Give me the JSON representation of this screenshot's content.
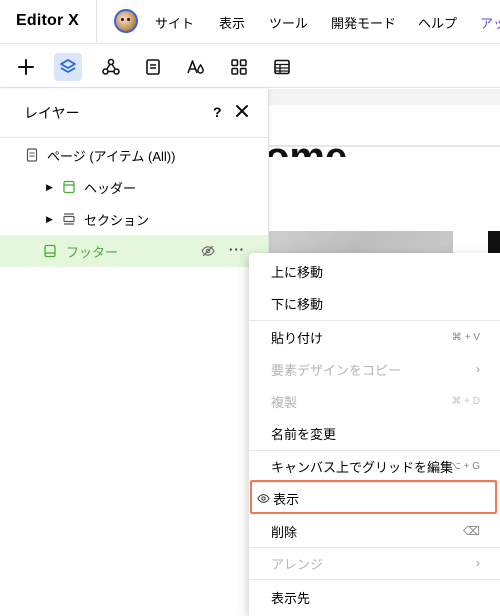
{
  "topbar": {
    "logo": "Editor X",
    "menu": [
      "サイト",
      "表示",
      "ツール",
      "開発モード",
      "ヘルプ",
      "アップ"
    ]
  },
  "toolbar": {
    "tools": [
      "add-icon",
      "layers-icon",
      "connect-icon",
      "pages-icon",
      "text-theme-icon",
      "apps-icon",
      "table-icon"
    ],
    "active": "layers-icon"
  },
  "layers_panel": {
    "title": "レイヤー",
    "help": "?",
    "items": [
      {
        "label": "ページ (アイテム (All))",
        "icon": "page-icon"
      },
      {
        "label": "ヘッダー",
        "icon": "header-icon"
      },
      {
        "label": "セクション",
        "icon": "section-icon"
      },
      {
        "label": "フッター",
        "icon": "footer-icon",
        "selected": true
      }
    ]
  },
  "context_menu": {
    "items": [
      {
        "label": "上に移動"
      },
      {
        "label": "下に移動"
      },
      {
        "label": "貼り付け",
        "shortcut": "⌘ + V"
      },
      {
        "label": "要素デザインをコピー",
        "disabled": true,
        "submenu": "›"
      },
      {
        "label": "複製",
        "disabled": true,
        "shortcut": "⌘ + D"
      },
      {
        "label": "名前を変更"
      },
      {
        "label": "キャンバス上でグリッドを編集",
        "shortcut": "⌥ + G"
      },
      {
        "label": "表示",
        "highlighted": true
      },
      {
        "label": "削除",
        "shortcut": "⌫"
      },
      {
        "label": "アレンジ",
        "disabled": true,
        "submenu": "›"
      },
      {
        "label": "表示先"
      }
    ]
  },
  "canvas": {
    "heading_fragment": "ome"
  },
  "colors": {
    "accent": "#6a45e6",
    "selection_bg": "#e4f7dd",
    "selection_text": "#4aaa3a",
    "active_tool_bg": "#d9e6fb",
    "highlight_border": "#f07a54"
  }
}
